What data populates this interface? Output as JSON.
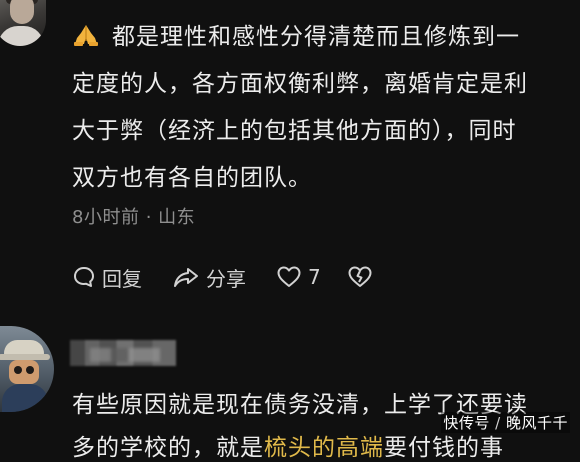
{
  "comment1": {
    "emoji_icon": "folded-hands-icon",
    "text": "都是理性和感性分得清楚而且修炼到一\n定度的人，各方面权衡利弊，离婚肯定是利\n大于弊（经济上的包括其他方面的），同时\n双方也有各自的团队。",
    "time": "8小时前",
    "separator": "·",
    "location": "山东",
    "actions": {
      "reply_label": "回复",
      "share_label": "分享",
      "like_count": "7"
    }
  },
  "comment2": {
    "line1": "有些原因就是现在债务没清，上学了还要读",
    "line2_prefix": "多的学校的，就是",
    "line2_highlight": "梳头的高端",
    "line2_suffix": "要付钱的事"
  },
  "watermark": {
    "brand": "快传号",
    "sep": "/",
    "author": "晚风千千"
  },
  "colors": {
    "background": "#101010",
    "text": "#ececec",
    "meta": "#8f8f8f",
    "highlight": "#e0b94a"
  }
}
